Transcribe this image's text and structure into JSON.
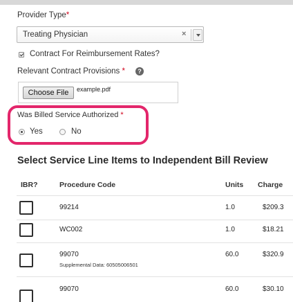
{
  "provider_type": {
    "label": "Provider Type",
    "required_mark": "*",
    "selected": "Treating Physician",
    "clear_glyph": "×"
  },
  "contract": {
    "checked": true,
    "label": "Contract For Reimbursement Rates?"
  },
  "provisions": {
    "label": "Relevant Contract Provisions",
    "required_mark": "*",
    "help_glyph": "?",
    "choose_button": "Choose File",
    "filename": "example.pdf"
  },
  "billed_service": {
    "label": "Was Billed Service Authorized",
    "required_mark": "*",
    "options": [
      {
        "label": "Yes",
        "selected": true
      },
      {
        "label": "No",
        "selected": false
      }
    ]
  },
  "service_lines": {
    "title": "Select Service Line Items to Independent Bill Review",
    "columns": [
      "IBR?",
      "Procedure Code",
      "Units",
      "Charge"
    ],
    "rows": [
      {
        "code": "99214",
        "supplemental": "",
        "units": "1.0",
        "charge": "$209.3"
      },
      {
        "code": "WC002",
        "supplemental": "",
        "units": "1.0",
        "charge": "$18.21"
      },
      {
        "code": "99070",
        "supplemental": "Supplemental Data: 60505006501",
        "units": "60.0",
        "charge": "$320.9"
      },
      {
        "code": "99070",
        "supplemental": "",
        "units": "60.0",
        "charge": "$30.10"
      }
    ]
  }
}
